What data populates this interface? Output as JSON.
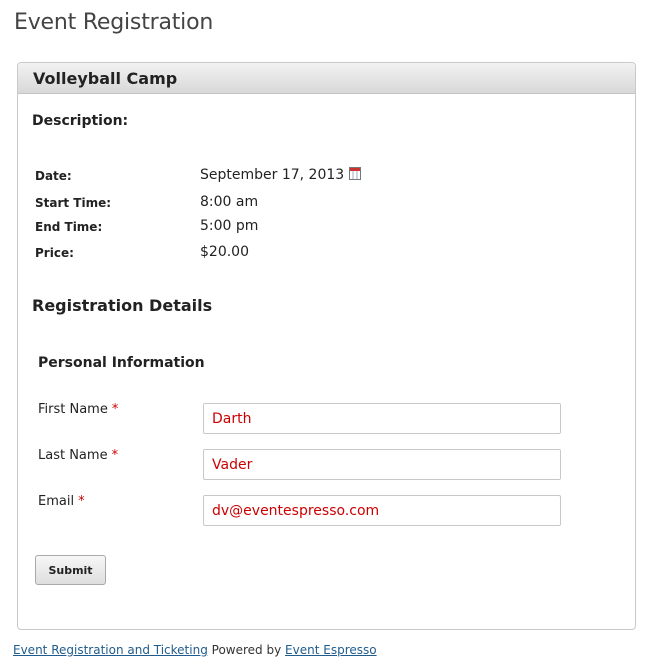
{
  "page": {
    "title": "Event Registration"
  },
  "event": {
    "name": "Volleyball Camp",
    "description_label": "Description:",
    "details": [
      {
        "label": "Date:",
        "value": "September 17, 2013"
      },
      {
        "label": "Start Time:",
        "value": "8:00 am"
      },
      {
        "label": "End Time:",
        "value": "5:00 pm"
      },
      {
        "label": "Price:",
        "value": "$20.00"
      }
    ],
    "calendar_icon": "calendar-icon"
  },
  "registration": {
    "title": "Registration Details",
    "personal_info_title": "Personal Information",
    "required_marker": "*",
    "fields": [
      {
        "label": "First Name",
        "value": "Darth"
      },
      {
        "label": "Last Name",
        "value": "Vader"
      },
      {
        "label": "Email",
        "value": "dv@eventespresso.com"
      }
    ],
    "submit_label": "Submit"
  },
  "footer": {
    "link1": "Event Registration and Ticketing",
    "powered_by": "Powered by",
    "link2": "Event Espresso"
  },
  "colors": {
    "required": "#cc0000",
    "link": "#1f5b8c"
  }
}
